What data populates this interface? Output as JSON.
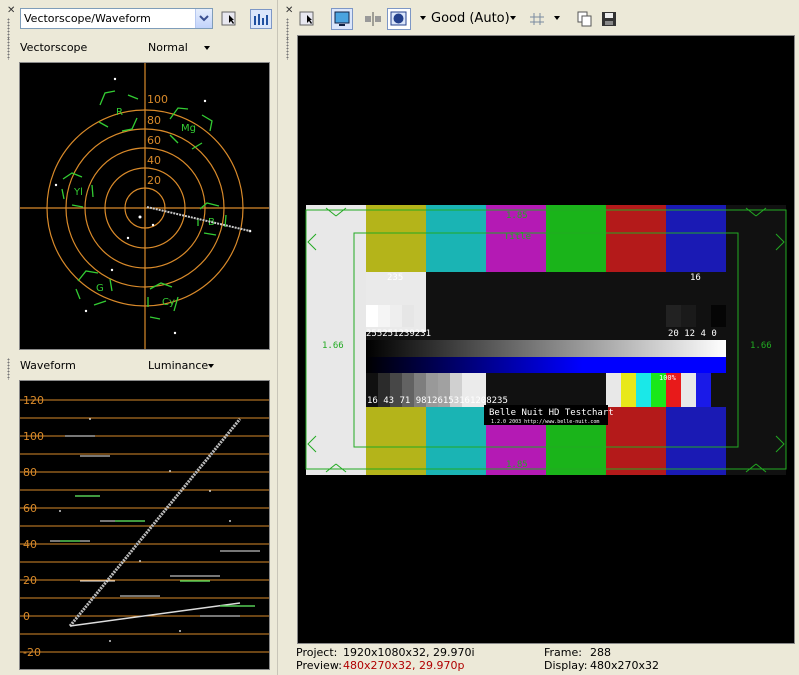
{
  "left": {
    "combo_value": "Vectorscope/Waveform",
    "vectorscope": {
      "label": "Vectorscope",
      "mode": "Normal",
      "ring_labels": [
        "100",
        "80",
        "60",
        "40",
        "20"
      ],
      "targets": [
        "R",
        "Mg",
        "Yl",
        "B",
        "G",
        "Cy"
      ]
    },
    "waveform": {
      "label": "Waveform",
      "mode": "Luminance",
      "ticks": [
        "120",
        "100",
        "80",
        "60",
        "40",
        "20",
        "0",
        "-20"
      ]
    }
  },
  "right": {
    "quality": "Good (Auto)",
    "testchart": {
      "safe_top": "1.85",
      "safe_bottom": "1.85",
      "title": "Title",
      "left_ratio": "1.66",
      "right_ratio": "1.66",
      "label_235": "235",
      "label_16": "16",
      "row_high": "255251239231",
      "row_low": "20 12  4  0",
      "steps": "16 43 71 98126153161208235",
      "percent": "100%",
      "chart_name": "Belle Nuit HD Testchart",
      "chart_sub": "1.2.0  2003  http://www.belle-nuit.com"
    },
    "status": {
      "project_label": "Project:",
      "project_value": "1920x1080x32, 29.970i",
      "preview_label": "Preview:",
      "preview_value": "480x270x32, 29.970p",
      "frame_label": "Frame:",
      "frame_value": "288",
      "display_label": "Display:",
      "display_value": "480x270x32"
    }
  },
  "colors": {
    "scope_orange": "#d98a2a",
    "scope_green": "#33cc33",
    "safe_green": "#22aa22"
  }
}
